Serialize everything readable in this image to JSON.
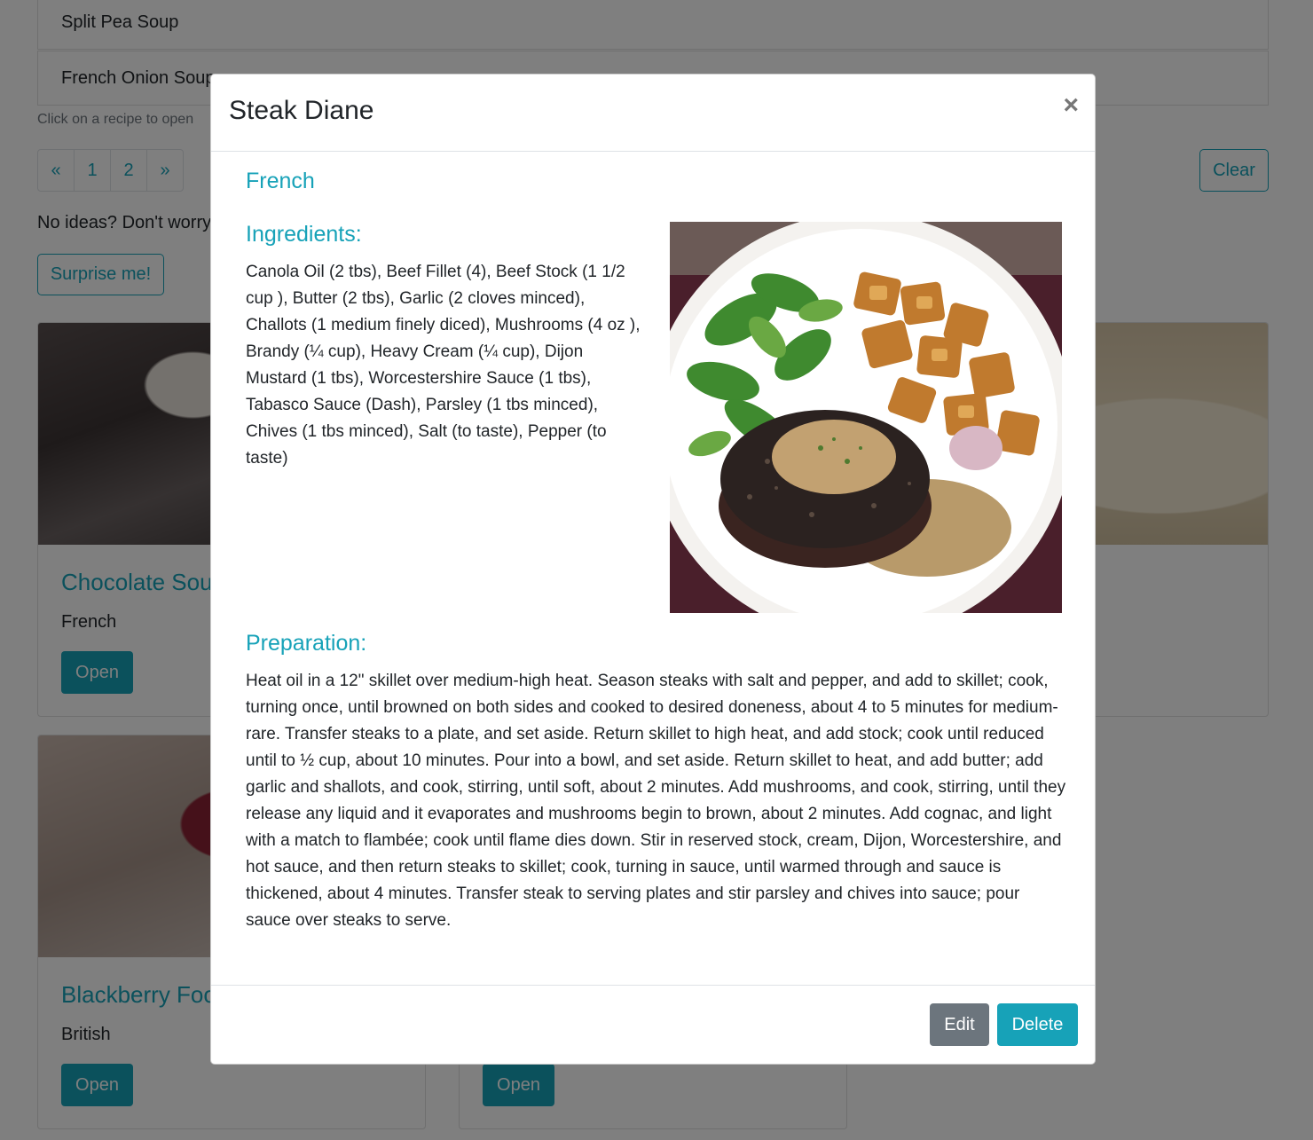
{
  "recipe_list": {
    "items": [
      "Split Pea Soup",
      "French Onion Soup"
    ],
    "helper_text": "Click on a recipe to open"
  },
  "pagination": {
    "prev": "«",
    "pages": [
      "1",
      "2"
    ],
    "next": "»"
  },
  "clear_label": "Clear",
  "no_ideas_text": "No ideas? Don't worry",
  "surprise_label": "Surprise me!",
  "cards": [
    {
      "title": "Chocolate Souf",
      "cuisine": "French",
      "open_label": "Open"
    },
    {
      "title": "Blackberry Foo",
      "cuisine": "British",
      "open_label": "Open"
    },
    {
      "title": "",
      "cuisine": "",
      "open_label": "Open"
    }
  ],
  "modal": {
    "title": "Steak Diane",
    "close_glyph": "×",
    "cuisine": "French",
    "ingredients_heading": "Ingredients:",
    "ingredients": "Canola Oil (2 tbs), Beef Fillet (4), Beef Stock (1 1/2 cup ), Butter (2 tbs), Garlic (2 cloves minced), Challots (1 medium finely diced), Mushrooms (4 oz ), Brandy (¼ cup), Heavy Cream (¼ cup), Dijon Mustard (1 tbs), Worcestershire Sauce (1 tbs), Tabasco Sauce (Dash), Parsley (1 tbs minced), Chives (1 tbs minced), Salt (to taste), Pepper (to taste)",
    "preparation_heading": "Preparation:",
    "preparation": "Heat oil in a 12\" skillet over medium-high heat. Season steaks with salt and pepper, and add to skillet; cook, turning once, until browned on both sides and cooked to desired doneness, about 4 to 5 minutes for medium-rare. Transfer steaks to a plate, and set aside. Return skillet to high heat, and add stock; cook until reduced until to ½ cup, about 10 minutes. Pour into a bowl, and set aside. Return skillet to heat, and add butter; add garlic and shallots, and cook, stirring, until soft, about 2 minutes. Add mushrooms, and cook, stirring, until they release any liquid and it evaporates and mushrooms begin to brown, about 2 minutes. Add cognac, and light with a match to flambée; cook until flame dies down. Stir in reserved stock, cream, Dijon, Worcestershire, and hot sauce, and then return steaks to skillet; cook, turning in sauce, until warmed through and sauce is thickened, about 4 minutes. Transfer steak to serving plates and stir parsley and chives into sauce; pour sauce over steaks to serve.",
    "edit_label": "Edit",
    "delete_label": "Delete"
  },
  "colors": {
    "accent": "#17a2b8",
    "secondary": "#6c757d",
    "backdrop": "rgba(0,0,0,0.5)"
  }
}
